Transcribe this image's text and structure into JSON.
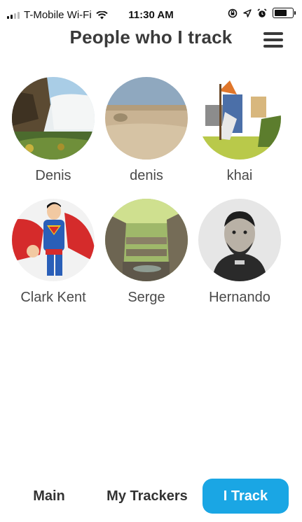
{
  "status_bar": {
    "carrier": "T-Mobile Wi-Fi",
    "time": "11:30 AM",
    "battery_level": 0.8
  },
  "header": {
    "title": "People who I track",
    "menu_icon": "hamburger-menu-icon"
  },
  "people": [
    {
      "name": "Denis",
      "avatar": "waterfall-landscape"
    },
    {
      "name": "denis",
      "avatar": "desert-sand"
    },
    {
      "name": "khai",
      "avatar": "wizard-cartoon"
    },
    {
      "name": "Clark Kent",
      "avatar": "superhero-cartoon"
    },
    {
      "name": "Serge",
      "avatar": "canyon-forest"
    },
    {
      "name": "Hernando",
      "avatar": "historical-portrait"
    }
  ],
  "tabs": [
    {
      "label": "Main",
      "active": false
    },
    {
      "label": "My Trackers",
      "active": false
    },
    {
      "label": "I Track",
      "active": true
    }
  ],
  "colors": {
    "accent": "#1aa6e4",
    "title": "#3a3a3a",
    "name_text": "#4a4a4a"
  }
}
